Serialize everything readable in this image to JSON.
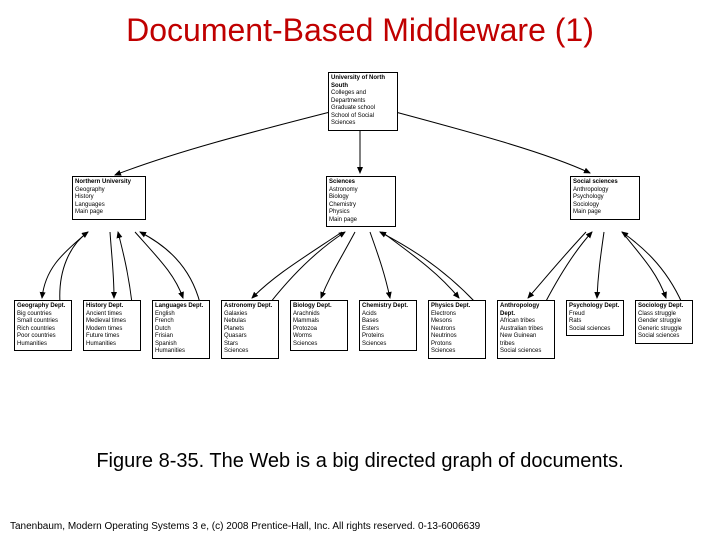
{
  "title": "Document-Based Middleware (1)",
  "caption": "Figure 8-35. The Web is a big directed graph of documents.",
  "copyright": "Tanenbaum, Modern Operating Systems 3 e, (c) 2008 Prentice-Hall, Inc. All rights reserved. 0-13-6006639",
  "top": {
    "header": "University of North South",
    "lines": [
      "Colleges and Departments",
      "Graduate school",
      "",
      "School of Social Sciences"
    ]
  },
  "mid": {
    "northern": {
      "header": "Northern University",
      "lines": [
        "Geography",
        "History",
        "Languages",
        "",
        "Main page"
      ]
    },
    "sciences": {
      "header": "Sciences",
      "lines": [
        "Astronomy",
        "Biology",
        "Chemistry",
        "Physics",
        "",
        "Main page"
      ]
    },
    "social": {
      "header": "Social sciences",
      "lines": [
        "Anthropology",
        "Psychology",
        "Sociology",
        "",
        "Main page"
      ]
    }
  },
  "dept": {
    "geography": {
      "header": "Geography Dept.",
      "lines": [
        "Big countries",
        "Small countries",
        "Rich countries",
        "Poor countries",
        "",
        "Humanities"
      ]
    },
    "history": {
      "header": "History Dept.",
      "lines": [
        "Ancient times",
        "Medieval times",
        "Modern times",
        "Future times",
        "",
        "Humanities"
      ]
    },
    "languages": {
      "header": "Languages Dept.",
      "lines": [
        "English",
        "French",
        "Dutch",
        "Frisian",
        "Spanish",
        "",
        "Humanities"
      ]
    },
    "astronomy": {
      "header": "Astronomy Dept.",
      "lines": [
        "Galaxies",
        "Nebulas",
        "Planets",
        "Quasars",
        "Stars",
        "",
        "Sciences"
      ]
    },
    "biology": {
      "header": "Biology Dept.",
      "lines": [
        "Arachnids",
        "Mammals",
        "Protozoa",
        "Worms",
        "",
        "Sciences"
      ]
    },
    "chemistry": {
      "header": "Chemistry Dept.",
      "lines": [
        "Acids",
        "Bases",
        "Esters",
        "Proteins",
        "",
        "Sciences"
      ]
    },
    "physics": {
      "header": "Physics Dept.",
      "lines": [
        "Electrons",
        "Mesons",
        "Neutrons",
        "Neutrinos",
        "Protons",
        "",
        "Sciences"
      ]
    },
    "anthro": {
      "header": "Anthropology Dept.",
      "lines": [
        "African tribes",
        "Australian tribes",
        "New Guinean tribes",
        "",
        "Social sciences"
      ]
    },
    "psych": {
      "header": "Psychology Dept.",
      "lines": [
        "Freud",
        "Rats",
        "",
        "Social sciences"
      ]
    },
    "sociology": {
      "header": "Sociology Dept.",
      "lines": [
        "Class struggle",
        "Gender struggle",
        "Generic struggle",
        "",
        "Social sciences"
      ]
    }
  }
}
